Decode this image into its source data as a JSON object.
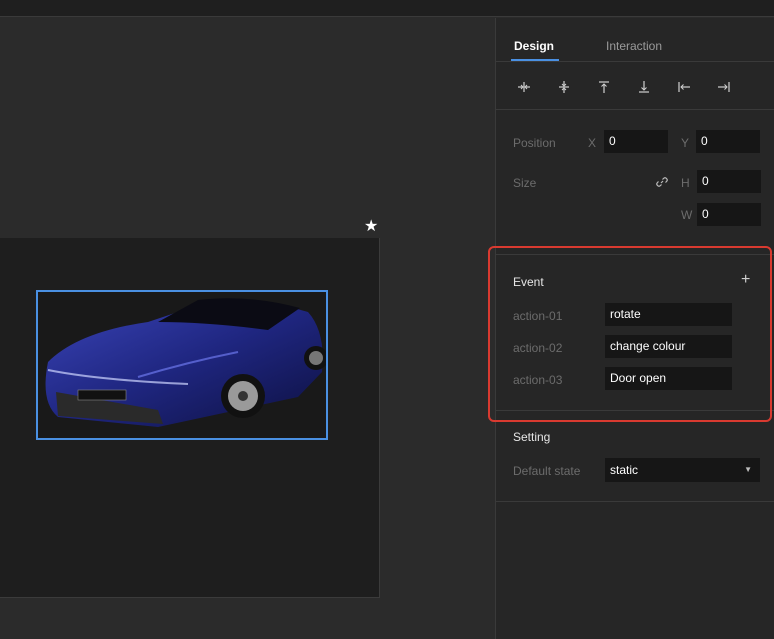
{
  "panel": {
    "tabs": [
      {
        "label": "Design",
        "active": true
      },
      {
        "label": "Interaction",
        "active": false
      }
    ],
    "align_icons": [
      "align-horizontal-center-icon",
      "align-vertical-center-icon",
      "align-top-icon",
      "align-bottom-icon",
      "align-left-icon",
      "align-right-icon"
    ],
    "position": {
      "label": "Position",
      "x_label": "X",
      "x_value": "0",
      "y_label": "Y",
      "y_value": "0"
    },
    "size": {
      "label": "Size",
      "h_label": "H",
      "h_value": "0",
      "w_label": "W",
      "w_value": "0"
    },
    "event": {
      "title": "Event",
      "add_icon": "plus-icon",
      "actions": [
        {
          "name": "action-01",
          "value": "rotate"
        },
        {
          "name": "action-02",
          "value": "change colour"
        },
        {
          "name": "action-03",
          "value": "Door open"
        }
      ]
    },
    "setting": {
      "title": "Setting",
      "default_state_label": "Default state",
      "default_state_value": "static"
    }
  },
  "canvas": {
    "marker_icon": "star-icon",
    "selected_object": "car-image"
  },
  "colors": {
    "accent": "#4a90e2",
    "highlight": "#d93a30",
    "panel_bg": "#262626",
    "field_bg": "#161616"
  }
}
